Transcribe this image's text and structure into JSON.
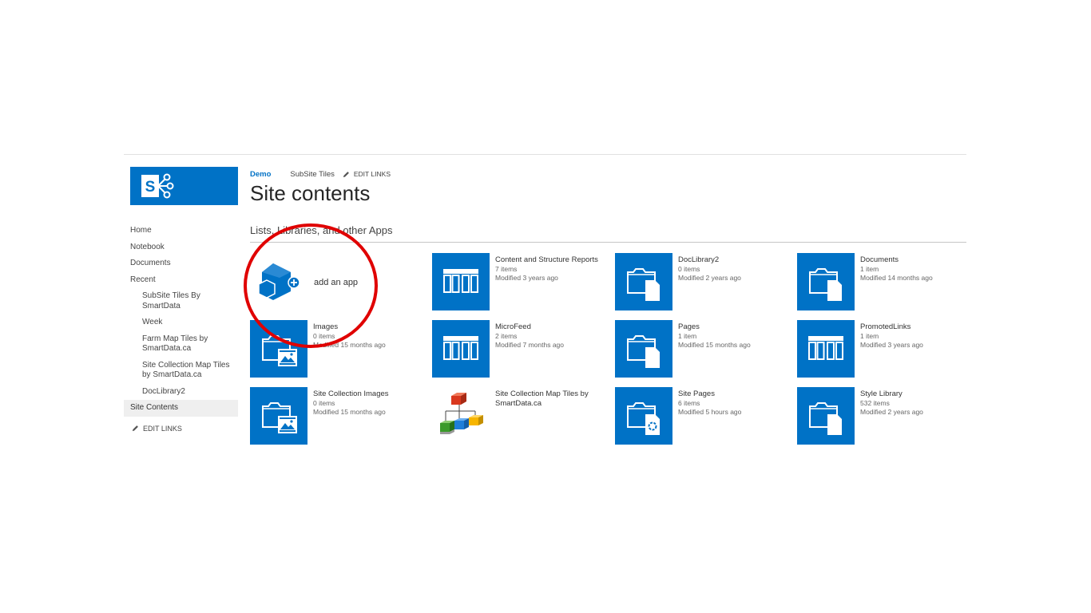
{
  "breadcrumb": {
    "site": "Demo",
    "subsite": "SubSite Tiles",
    "edit_links": "EDIT LINKS"
  },
  "page": {
    "title": "Site contents",
    "section_title": "Lists, Libraries, and other Apps"
  },
  "left_nav": {
    "items": [
      {
        "label": "Home"
      },
      {
        "label": "Notebook"
      },
      {
        "label": "Documents"
      },
      {
        "label": "Recent"
      },
      {
        "label": "SubSite Tiles By SmartData"
      },
      {
        "label": "Week"
      },
      {
        "label": "Farm Map Tiles by SmartData.ca"
      },
      {
        "label": "Site Collection Map Tiles by SmartData.ca"
      },
      {
        "label": "DocLibrary2"
      },
      {
        "label": "Site Contents"
      }
    ],
    "edit_links": "EDIT LINKS"
  },
  "add_app": {
    "label": "add an app",
    "icon": "add-app-icon"
  },
  "tiles": [
    {
      "name": "Content and Structure Reports",
      "count": "7 items",
      "modified": "Modified 3 years ago",
      "icon": "list-icon"
    },
    {
      "name": "DocLibrary2",
      "count": "0 items",
      "modified": "Modified 2 years ago",
      "icon": "document-library-icon"
    },
    {
      "name": "Documents",
      "count": "1 item",
      "modified": "Modified 14 months ago",
      "icon": "document-library-icon"
    },
    {
      "name": "Images",
      "count": "0 items",
      "modified": "Modified 15 months ago",
      "icon": "image-library-icon"
    },
    {
      "name": "MicroFeed",
      "count": "2 items",
      "modified": "Modified 7 months ago",
      "icon": "list-icon"
    },
    {
      "name": "Pages",
      "count": "1 item",
      "modified": "Modified 15 months ago",
      "icon": "document-library-icon"
    },
    {
      "name": "PromotedLinks",
      "count": "1 item",
      "modified": "Modified 3 years ago",
      "icon": "list-icon"
    },
    {
      "name": "Site Collection Images",
      "count": "0 items",
      "modified": "Modified 15 months ago",
      "icon": "image-library-icon"
    },
    {
      "name": "Site Collection Map Tiles by SmartData.ca",
      "count": "",
      "modified": "",
      "icon": "colored-blocks-app-icon"
    },
    {
      "name": "Site Pages",
      "count": "6 items",
      "modified": "Modified 5 hours ago",
      "icon": "wiki-page-library-icon"
    },
    {
      "name": "Style Library",
      "count": "532 items",
      "modified": "Modified 2 years ago",
      "icon": "document-library-icon"
    }
  ],
  "colors": {
    "accent": "#0072c6",
    "highlight_circle": "#e00000",
    "selected_nav_bg": "#efefef"
  }
}
